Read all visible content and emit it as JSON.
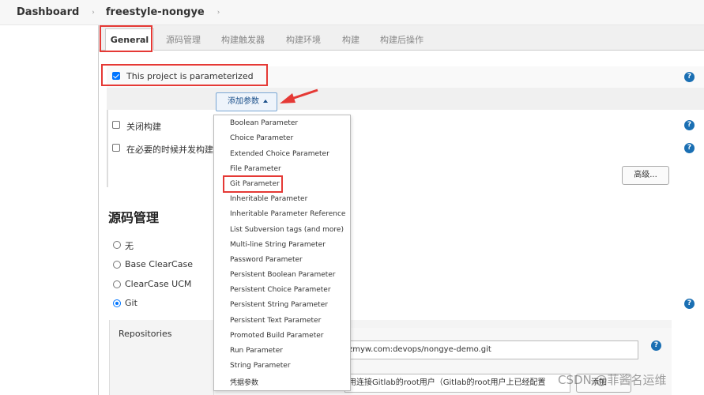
{
  "breadcrumb": {
    "items": [
      "Dashboard",
      "freestyle-nongye"
    ],
    "separator": "›"
  },
  "tabs": [
    {
      "label": "General",
      "active": true
    },
    {
      "label": "源码管理"
    },
    {
      "label": "构建触发器"
    },
    {
      "label": "构建环境"
    },
    {
      "label": "构建"
    },
    {
      "label": "构建后操作"
    }
  ],
  "general": {
    "parameterized_label": "This project is parameterized",
    "parameterized_checked": true,
    "add_param_label": "添加参数",
    "disable_build_label": "关闭构建",
    "concurrent_build_label": "在必要的时候并发构建",
    "advanced_label": "高级...",
    "help_glyph": "?"
  },
  "dropdown": {
    "items": [
      "Boolean Parameter",
      "Choice Parameter",
      "Extended Choice Parameter",
      "File Parameter",
      "Git Parameter",
      "Inheritable Parameter",
      "Inheritable Parameter Reference",
      "List Subversion tags (and more)",
      "Multi-line String Parameter",
      "Password Parameter",
      "Persistent Boolean Parameter",
      "Persistent Choice Parameter",
      "Persistent String Parameter",
      "Persistent Text Parameter",
      "Promoted Build Parameter",
      "Run Parameter",
      "String Parameter",
      "凭据参数"
    ],
    "highlighted": "Git Parameter"
  },
  "scm": {
    "title": "源码管理",
    "options": [
      {
        "label": "无",
        "checked": false
      },
      {
        "label": "Base ClearCase",
        "checked": false
      },
      {
        "label": "ClearCase UCM",
        "checked": false
      },
      {
        "label": "Git",
        "checked": true
      }
    ],
    "repositories_label": "Repositories",
    "repo_url": "zmyw.com:devops/nongye-demo.git",
    "credentials_value": "用连接Gitlab的root用户（Gitlab的root用户上已经配置",
    "add_credentials_label": "添加"
  },
  "watermark": "CSDN @菲酱名运维",
  "colors": {
    "highlight_red": "#e53935",
    "help_blue": "#1a6fb3",
    "checkbox_blue": "#0075ff"
  }
}
